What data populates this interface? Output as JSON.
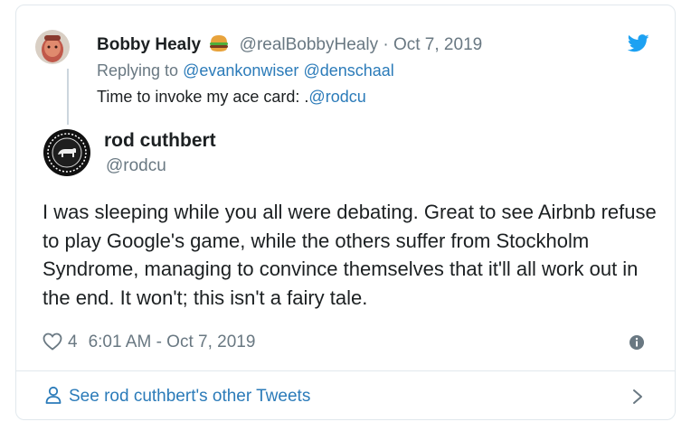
{
  "reply_tweet": {
    "author_name": "Bobby Healy",
    "author_emoji": "🍔",
    "author_handle": "@realBobbyHealy",
    "separator": "·",
    "date": "Oct 7, 2019",
    "replying_to_prefix": "Replying to",
    "replying_to_mention_1": "@evankonwiser",
    "replying_to_mention_2": "@denschaal",
    "text_prefix": "Time to invoke my ace card: .",
    "text_mention": "@rodcu"
  },
  "main_tweet": {
    "author_name": "rod cuthbert",
    "author_handle": "@rodcu",
    "text": "I was sleeping while you all were debating. Great to see Airbnb refuse to play Google's game, while the others suffer from Stockholm Syndrome, managing to convince themselves that it'll all work out in the end. It won't; this isn't a fairy tale.",
    "like_count": "4",
    "timestamp": "6:01 AM - Oct 7, 2019"
  },
  "footer": {
    "see_more_label": "See rod cuthbert's other Tweets"
  },
  "icons": {
    "brand": "twitter-bird-icon",
    "like": "heart-icon",
    "info": "info-icon",
    "profile": "person-icon",
    "chevron": "chevron-right-icon"
  },
  "colors": {
    "link": "#2b7bb9",
    "twitter_blue": "#1da1f2",
    "secondary_text": "#697882",
    "primary_text": "#1c2022",
    "border": "#e1e8ed"
  }
}
